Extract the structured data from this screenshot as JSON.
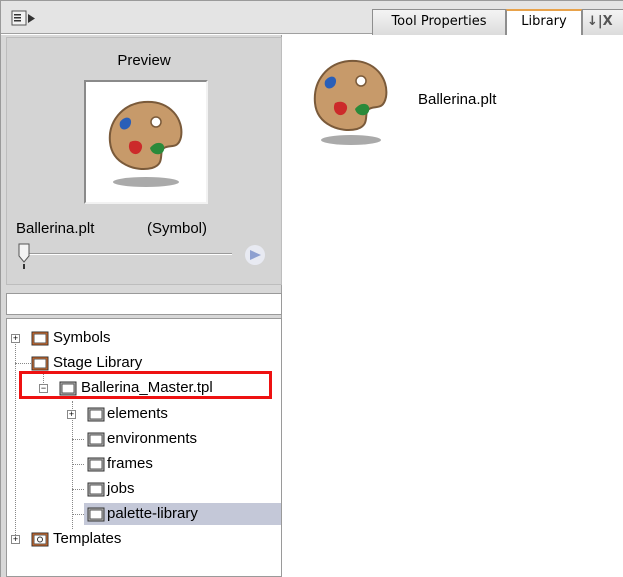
{
  "toolbar": {
    "menu_icon": "panel-menu-icon",
    "tabs": [
      {
        "label": "Tool Properties",
        "active": false
      },
      {
        "label": "Library",
        "active": true
      },
      {
        "label": "↓|X",
        "active": false
      }
    ]
  },
  "preview": {
    "title": "Preview",
    "name": "Ballerina.plt",
    "type": "(Symbol)",
    "icon": "palette-icon"
  },
  "tree": {
    "items": [
      {
        "label": "Symbols",
        "expander": "+",
        "icon": "folder-icon"
      },
      {
        "label": "Stage Library",
        "expander": "",
        "icon": "folder-icon"
      },
      {
        "label": "Ballerina_Master.tpl",
        "expander": "−",
        "icon": "folder-icon"
      },
      {
        "label": "elements",
        "expander": "+",
        "icon": "folder-icon"
      },
      {
        "label": "environments",
        "expander": "",
        "icon": "folder-icon"
      },
      {
        "label": "frames",
        "expander": "",
        "icon": "folder-icon"
      },
      {
        "label": "jobs",
        "expander": "",
        "icon": "folder-icon"
      },
      {
        "label": "palette-library",
        "expander": "",
        "icon": "folder-icon",
        "selected": true
      },
      {
        "label": "Templates",
        "expander": "+",
        "icon": "templates-folder-icon"
      }
    ]
  },
  "library": {
    "items": [
      {
        "label": "Ballerina.plt",
        "icon": "palette-icon"
      }
    ]
  },
  "colors": {
    "highlight": "#ee1111",
    "selection": "#c4c8d8",
    "folder_orange": "#e46a1e"
  }
}
